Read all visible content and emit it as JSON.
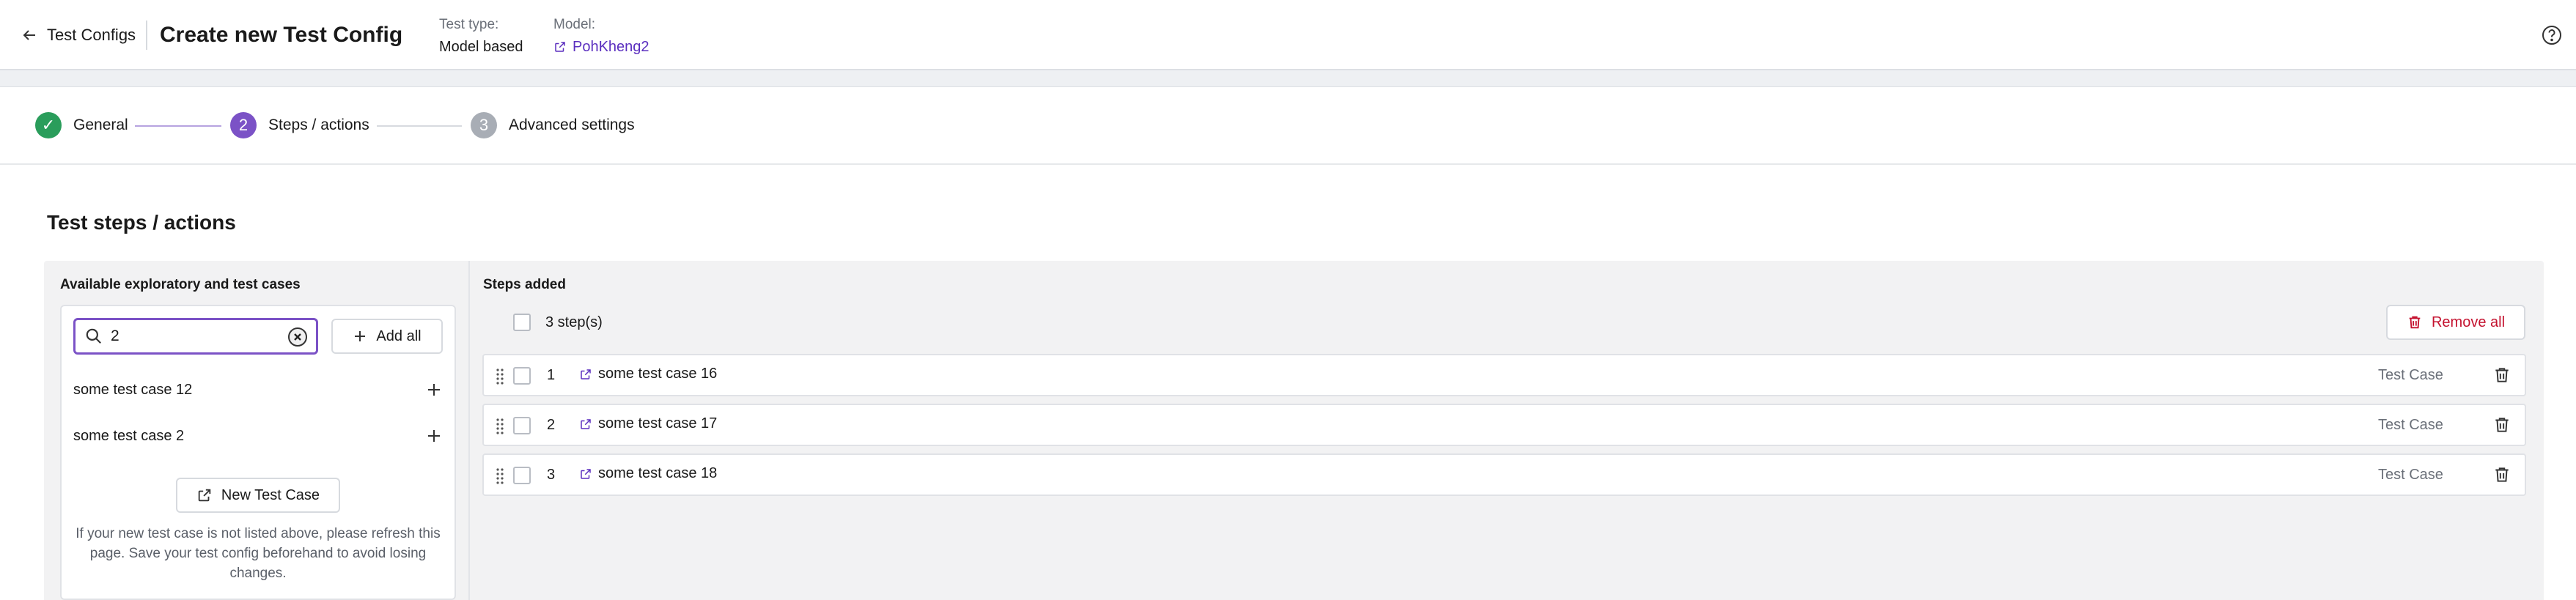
{
  "header": {
    "back_label": "Test Configs",
    "title": "Create new Test Config",
    "test_type_label": "Test type:",
    "test_type_value": "Model based",
    "model_label": "Model:",
    "model_value": "PohKheng2"
  },
  "stepper": {
    "steps": [
      {
        "label": "General",
        "state": "completed",
        "marker": "✓"
      },
      {
        "label": "Steps / actions",
        "state": "active",
        "marker": "2"
      },
      {
        "label": "Advanced settings",
        "state": "pending",
        "marker": "3"
      }
    ]
  },
  "section_title": "Test steps / actions",
  "available": {
    "title": "Available exploratory and test cases",
    "search_value": "2",
    "add_all_label": "Add all",
    "items": [
      {
        "label": "some test case 12"
      },
      {
        "label": "some test case 2"
      }
    ],
    "new_case_label": "New Test Case",
    "hint": "If your new test case is not listed above, please refresh this page. Save your test config beforehand to avoid losing changes."
  },
  "added": {
    "title": "Steps added",
    "count_label": "3 step(s)",
    "remove_all_label": "Remove all",
    "rows": [
      {
        "num": "1",
        "name": "some test case 16",
        "type": "Test Case"
      },
      {
        "num": "2",
        "name": "some test case 17",
        "type": "Test Case"
      },
      {
        "num": "3",
        "name": "some test case 18",
        "type": "Test Case"
      }
    ]
  },
  "colors": {
    "accent": "#7b52c6",
    "success": "#2a9d5b",
    "danger": "#c4122f",
    "link": "#5b2fbf"
  },
  "icons": [
    "arrow-left-icon",
    "external-link-icon",
    "help-icon",
    "check-icon",
    "search-icon",
    "clear-icon",
    "plus-icon",
    "trash-icon",
    "drag-handle-icon"
  ]
}
